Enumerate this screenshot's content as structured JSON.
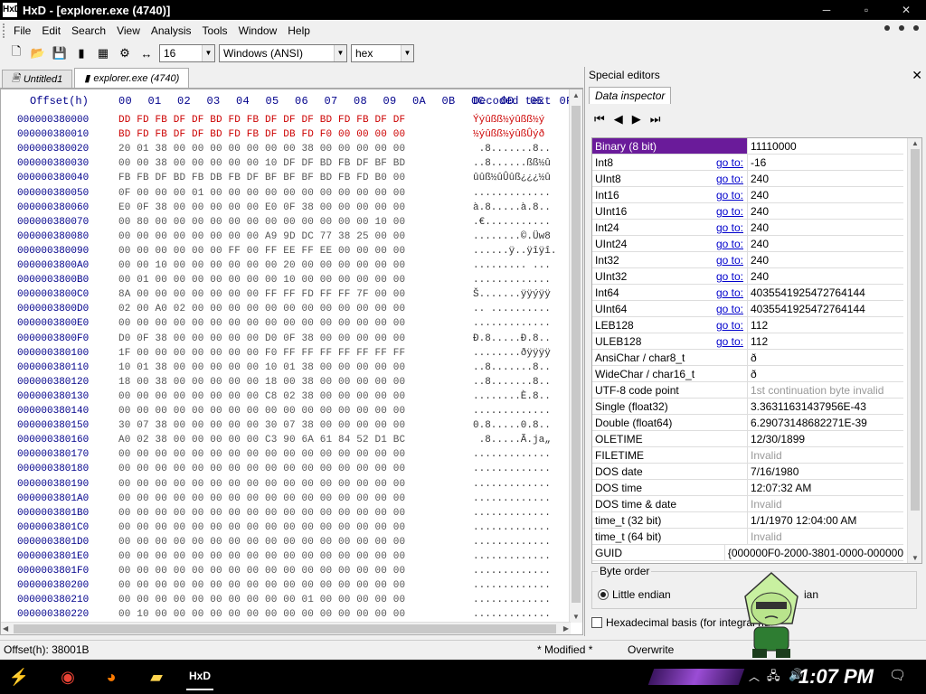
{
  "window": {
    "title": "HxD - [explorer.exe (4740)]",
    "app_icon": "HxD"
  },
  "menu": [
    "File",
    "Edit",
    "Search",
    "View",
    "Analysis",
    "Tools",
    "Window",
    "Help"
  ],
  "toolbar": {
    "bytes_per_row": "16",
    "charset": "Windows (ANSI)",
    "offset_base": "hex"
  },
  "tabs": [
    {
      "label": "Untitled1",
      "active": false
    },
    {
      "label": "explorer.exe (4740)",
      "active": true
    }
  ],
  "hex": {
    "header": {
      "offset": "Offset(h)",
      "columns": [
        "00",
        "01",
        "02",
        "03",
        "04",
        "05",
        "06",
        "07",
        "08",
        "09",
        "0A",
        "0B",
        "0C",
        "0D",
        "0E",
        "0F"
      ],
      "decoded": "Decoded text"
    },
    "rows": [
      {
        "off": "000000380000",
        "bytes": "DD FD FB DF DF BD FD FB DF DF DF BD FD FB DF DF",
        "dec": "Ýýûßß½ýûßß½ý",
        "hi": true
      },
      {
        "off": "000000380010",
        "bytes": "BD FD FB DF DF BD FD FB DF DB FD F0 00 00 00 00",
        "dec": "½ýûßß½ýûßÛýð",
        "hi": true
      },
      {
        "off": "000000380020",
        "bytes": "20 01 38 00 00 00 00 00 00 00 38 00 00 00 00 00",
        "dec": " .8.......8.."
      },
      {
        "off": "000000380030",
        "bytes": "00 00 38 00 00 00 00 00 10 DF DF BD FB DF BF BD",
        "dec": "..8......ßß½û"
      },
      {
        "off": "000000380040",
        "bytes": "FB FB DF BD FB DB FB DF BF BF BF BD FB FD B0 00",
        "dec": "ûûß½ûÛûß¿¿¿½û"
      },
      {
        "off": "000000380050",
        "bytes": "0F 00 00 00 01 00 00 00 00 00 00 00 00 00 00 00",
        "dec": "............."
      },
      {
        "off": "000000380060",
        "bytes": "E0 0F 38 00 00 00 00 00 E0 0F 38 00 00 00 00 00",
        "dec": "à.8.....à.8.."
      },
      {
        "off": "000000380070",
        "bytes": "00 80 00 00 00 00 00 00 00 00 00 00 00 00 10 00",
        "dec": ".€..........."
      },
      {
        "off": "000000380080",
        "bytes": "00 00 00 00 00 00 00 00 A9 9D DC 77 38 25 00 00",
        "dec": "........©.Üw8"
      },
      {
        "off": "000000380090",
        "bytes": "00 00 00 00 00 00 FF 00 FF EE FF EE 00 00 00 00",
        "dec": "......ÿ..ÿîÿî."
      },
      {
        "off": "0000003800A0",
        "bytes": "00 00 10 00 00 00 00 00 00 20 00 00 00 00 00 00",
        "dec": "......... ..."
      },
      {
        "off": "0000003800B0",
        "bytes": "00 01 00 00 00 00 00 00 00 10 00 00 00 00 00 00",
        "dec": "............."
      },
      {
        "off": "0000003800C0",
        "bytes": "8A 00 00 00 00 00 00 00 FF FF FD FF FF 7F 00 00",
        "dec": "Š.......ÿÿýÿÿ"
      },
      {
        "off": "0000003800D0",
        "bytes": "02 00 A0 02 00 00 00 00 00 00 00 00 00 00 00 00",
        "dec": ".. .........."
      },
      {
        "off": "0000003800E0",
        "bytes": "00 00 00 00 00 00 00 00 00 00 00 00 00 00 00 00",
        "dec": "............."
      },
      {
        "off": "0000003800F0",
        "bytes": "D0 0F 38 00 00 00 00 00 D0 0F 38 00 00 00 00 00",
        "dec": "Ð.8.....Ð.8.."
      },
      {
        "off": "000000380100",
        "bytes": "1F 00 00 00 00 00 00 00 F0 FF FF FF FF FF FF FF",
        "dec": "........ðÿÿÿÿ"
      },
      {
        "off": "000000380110",
        "bytes": "10 01 38 00 00 00 00 00 10 01 38 00 00 00 00 00",
        "dec": "..8.......8.."
      },
      {
        "off": "000000380120",
        "bytes": "18 00 38 00 00 00 00 00 18 00 38 00 00 00 00 00",
        "dec": "..8.......8.."
      },
      {
        "off": "000000380130",
        "bytes": "00 00 00 00 00 00 00 00 C8 02 38 00 00 00 00 00",
        "dec": "........È.8.."
      },
      {
        "off": "000000380140",
        "bytes": "00 00 00 00 00 00 00 00 00 00 00 00 00 00 00 00",
        "dec": "............."
      },
      {
        "off": "000000380150",
        "bytes": "30 07 38 00 00 00 00 00 30 07 38 00 00 00 00 00",
        "dec": "0.8.....0.8.."
      },
      {
        "off": "000000380160",
        "bytes": "A0 02 38 00 00 00 00 00 C3 90 6A 61 84 52 D1 BC",
        "dec": " .8.....Ã.ja„"
      },
      {
        "off": "000000380170",
        "bytes": "00 00 00 00 00 00 00 00 00 00 00 00 00 00 00 00",
        "dec": "............."
      },
      {
        "off": "000000380180",
        "bytes": "00 00 00 00 00 00 00 00 00 00 00 00 00 00 00 00",
        "dec": "............."
      },
      {
        "off": "000000380190",
        "bytes": "00 00 00 00 00 00 00 00 00 00 00 00 00 00 00 00",
        "dec": "............."
      },
      {
        "off": "0000003801A0",
        "bytes": "00 00 00 00 00 00 00 00 00 00 00 00 00 00 00 00",
        "dec": "............."
      },
      {
        "off": "0000003801B0",
        "bytes": "00 00 00 00 00 00 00 00 00 00 00 00 00 00 00 00",
        "dec": "............."
      },
      {
        "off": "0000003801C0",
        "bytes": "00 00 00 00 00 00 00 00 00 00 00 00 00 00 00 00",
        "dec": "............."
      },
      {
        "off": "0000003801D0",
        "bytes": "00 00 00 00 00 00 00 00 00 00 00 00 00 00 00 00",
        "dec": "............."
      },
      {
        "off": "0000003801E0",
        "bytes": "00 00 00 00 00 00 00 00 00 00 00 00 00 00 00 00",
        "dec": "............."
      },
      {
        "off": "0000003801F0",
        "bytes": "00 00 00 00 00 00 00 00 00 00 00 00 00 00 00 00",
        "dec": "............."
      },
      {
        "off": "000000380200",
        "bytes": "00 00 00 00 00 00 00 00 00 00 00 00 00 00 00 00",
        "dec": "............."
      },
      {
        "off": "000000380210",
        "bytes": "00 00 00 00 00 00 00 00 00 00 01 00 00 00 00 00",
        "dec": "............."
      },
      {
        "off": "000000380220",
        "bytes": "00 10 00 00 00 00 00 00 00 00 00 00 00 00 00 00",
        "dec": "............."
      }
    ]
  },
  "special_editors": {
    "title": "Special editors",
    "tab": "Data inspector",
    "goto_label": "go to:",
    "rows": [
      {
        "name": "Binary (8 bit)",
        "value": "11110000",
        "goto": false,
        "selected": true
      },
      {
        "name": "Int8",
        "value": "-16",
        "goto": true
      },
      {
        "name": "UInt8",
        "value": "240",
        "goto": true
      },
      {
        "name": "Int16",
        "value": "240",
        "goto": true
      },
      {
        "name": "UInt16",
        "value": "240",
        "goto": true
      },
      {
        "name": "Int24",
        "value": "240",
        "goto": true
      },
      {
        "name": "UInt24",
        "value": "240",
        "goto": true
      },
      {
        "name": "Int32",
        "value": "240",
        "goto": true
      },
      {
        "name": "UInt32",
        "value": "240",
        "goto": true
      },
      {
        "name": "Int64",
        "value": "4035541925472764144",
        "goto": true
      },
      {
        "name": "UInt64",
        "value": "4035541925472764144",
        "goto": true
      },
      {
        "name": "LEB128",
        "value": "112",
        "goto": true
      },
      {
        "name": "ULEB128",
        "value": "112",
        "goto": true
      },
      {
        "name": "AnsiChar / char8_t",
        "value": "ð",
        "goto": false
      },
      {
        "name": "WideChar / char16_t",
        "value": "ð",
        "goto": false
      },
      {
        "name": "UTF-8 code point",
        "value": "1st continuation byte invalid",
        "goto": false,
        "gray": true
      },
      {
        "name": "Single (float32)",
        "value": "3.36311631437956E-43",
        "goto": false
      },
      {
        "name": "Double (float64)",
        "value": "6.29073148682271E-39",
        "goto": false
      },
      {
        "name": "OLETIME",
        "value": "12/30/1899",
        "goto": false
      },
      {
        "name": "FILETIME",
        "value": "Invalid",
        "goto": false,
        "gray": true
      },
      {
        "name": "DOS date",
        "value": "7/16/1980",
        "goto": false
      },
      {
        "name": "DOS time",
        "value": "12:07:32 AM",
        "goto": false
      },
      {
        "name": "DOS time & date",
        "value": "Invalid",
        "goto": false,
        "gray": true
      },
      {
        "name": "time_t (32 bit)",
        "value": "1/1/1970 12:04:00 AM",
        "goto": false
      },
      {
        "name": "time_t (64 bit)",
        "value": "Invalid",
        "goto": false,
        "gray": true
      },
      {
        "name": "GUID",
        "value": "{000000F0-2000-3801-0000-000000",
        "goto": false
      }
    ],
    "byte_order_label": "Byte order",
    "little_endian": "Little endian",
    "big_endian_tail": "ian",
    "hex_basis": "Hexadecimal basis (for integral nu"
  },
  "status": {
    "offset": "Offset(h): 38001B",
    "modified": "* Modified *",
    "mode": "Overwrite"
  },
  "taskbar": {
    "clock": "1:07 PM"
  }
}
